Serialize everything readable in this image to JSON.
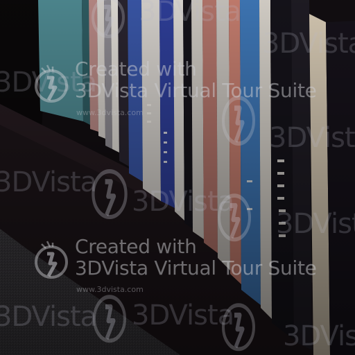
{
  "scene": {
    "colors": {
      "background": "#0e0b0d",
      "wall": "#1a1418",
      "floor_carpet": "#3b393d",
      "teal_spine": "#4f8a92",
      "pink_spine": "#b98a86",
      "blue_spine": "#3a57a8",
      "white_spine": "#d8d4cf",
      "black_spine": "#15131a",
      "cream_spine": "#d9ccb6"
    }
  },
  "watermark": {
    "line1": "Created with",
    "line2": "3DVista Virtual Tour Suite",
    "url": "www.3dvista.com",
    "brand": "3DVista",
    "logo_icon": "3dvista-logo-icon",
    "color": "#cfcfd4"
  }
}
